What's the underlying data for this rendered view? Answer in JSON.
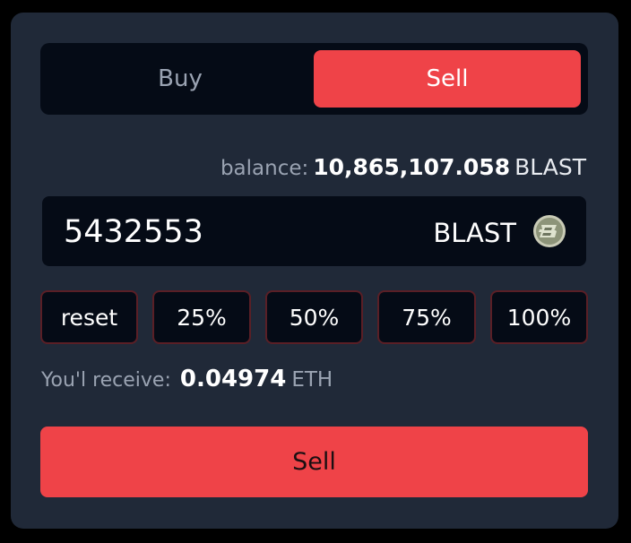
{
  "tabs": {
    "buy_label": "Buy",
    "sell_label": "Sell",
    "active": "Sell"
  },
  "balance": {
    "label": "balance:",
    "value": "10,865,107.058",
    "unit": "BLAST"
  },
  "amount": {
    "value": "5432553",
    "token": "BLAST",
    "token_icon": "blast-token-icon"
  },
  "presets": [
    {
      "label": "reset"
    },
    {
      "label": "25%"
    },
    {
      "label": "50%"
    },
    {
      "label": "75%"
    },
    {
      "label": "100%"
    }
  ],
  "receive": {
    "label": "You'l receive:",
    "value": "0.04974",
    "unit": "ETH"
  },
  "submit": {
    "label": "Sell"
  },
  "colors": {
    "card_bg": "#202938",
    "field_bg": "#050b16",
    "accent": "#ef4348",
    "muted_text": "#9aa3b2",
    "preset_border": "#5a1f26"
  }
}
